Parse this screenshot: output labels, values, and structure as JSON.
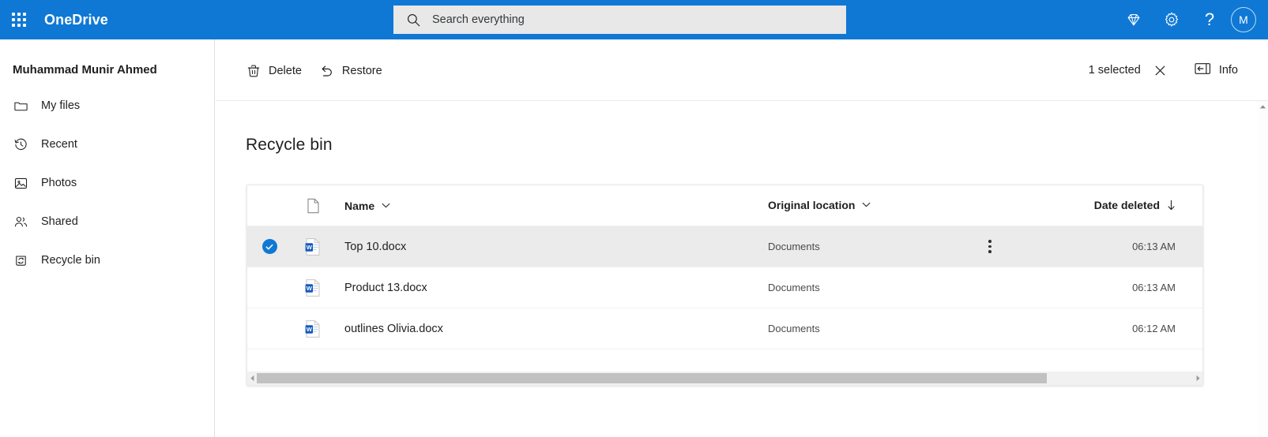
{
  "suite": {
    "waffle_label": "app-launcher",
    "brand": "OneDrive",
    "search": {
      "placeholder": "Search everything",
      "value": "",
      "icon": "search-icon"
    },
    "actions": [
      {
        "name": "premium-diamond-icon",
        "label": "Premium"
      },
      {
        "name": "gear-icon",
        "label": "Settings"
      },
      {
        "name": "help-icon",
        "label": "?"
      }
    ],
    "avatar_initial": "M",
    "brand_color": "#0f78d4"
  },
  "sidebar": {
    "account_name": "Muhammad Munir Ahmed",
    "items": [
      {
        "label": "My files",
        "icon": "folder-icon"
      },
      {
        "label": "Recent",
        "icon": "clock-history-icon"
      },
      {
        "label": "Photos",
        "icon": "photo-icon"
      },
      {
        "label": "Shared",
        "icon": "people-icon"
      },
      {
        "label": "Recycle bin",
        "icon": "recycle-bin-icon"
      }
    ]
  },
  "commandbar": {
    "delete_label": "Delete",
    "delete_icon": "trash-icon",
    "restore_label": "Restore",
    "restore_icon": "undo-arrow-icon",
    "selected_text": "1 selected",
    "close_icon": "close-icon",
    "info_label": "Info",
    "info_icon": "info-panel-icon"
  },
  "main": {
    "page_title": "Recycle bin",
    "columns": {
      "type_icon": "file-type-icon",
      "name": "Name",
      "original_location": "Original location",
      "date_deleted": "Date deleted",
      "sort_indicator": "↓"
    },
    "rows": [
      {
        "name": "Top 10.docx",
        "icon": "word-doc-icon",
        "original_location": "Documents",
        "date_deleted": "06:13 AM",
        "selected": true
      },
      {
        "name": "Product 13.docx",
        "icon": "word-doc-icon",
        "original_location": "Documents",
        "date_deleted": "06:13 AM",
        "selected": false
      },
      {
        "name": "outlines Olivia.docx",
        "icon": "word-doc-icon",
        "original_location": "Documents",
        "date_deleted": "06:12 AM",
        "selected": false
      }
    ]
  }
}
